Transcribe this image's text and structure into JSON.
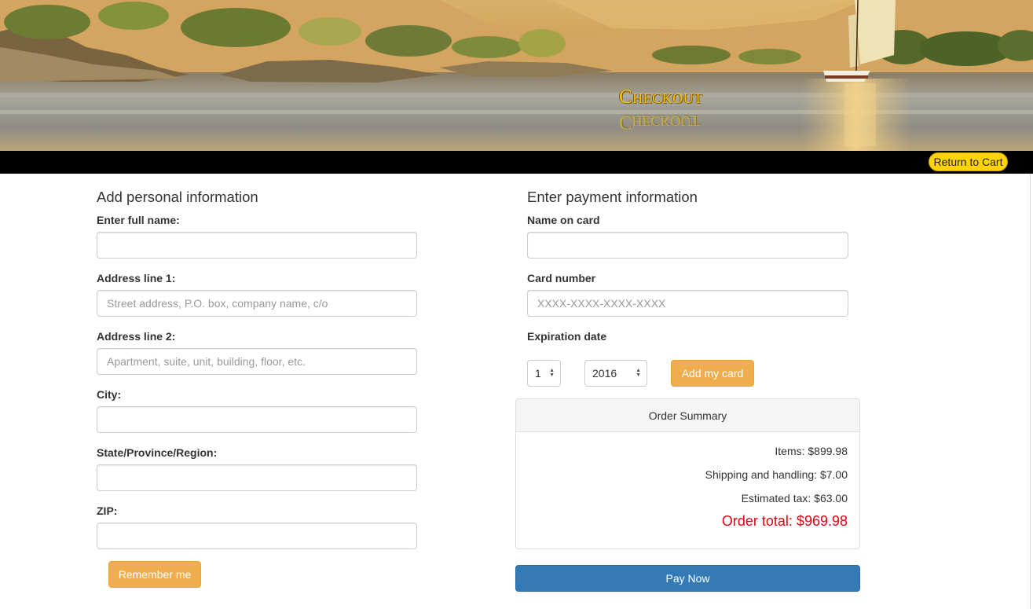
{
  "banner": {
    "title": "Checkout"
  },
  "topbar": {
    "return_label": "Return to Cart",
    "accent_color": "#ffd400"
  },
  "personal": {
    "heading": "Add personal information",
    "fields": [
      {
        "label": "Enter full name:",
        "value": "",
        "placeholder": ""
      },
      {
        "label": "Address line 1:",
        "value": "",
        "placeholder": "Street address, P.O. box, company name, c/o"
      },
      {
        "label": "Address line 2:",
        "value": "",
        "placeholder": "Apartment, suite, unit, building, floor, etc."
      },
      {
        "label": "City:",
        "value": "",
        "placeholder": ""
      },
      {
        "label": "State/Province/Region:",
        "value": "",
        "placeholder": ""
      },
      {
        "label": "ZIP:",
        "value": "",
        "placeholder": ""
      }
    ],
    "remember_label": "Remember me"
  },
  "payment": {
    "heading": "Enter payment information",
    "name_label": "Name on card",
    "name_value": "",
    "card_label": "Card number",
    "card_placeholder": "XXXX-XXXX-XXXX-XXXX",
    "exp_label": "Expiration date",
    "exp_month": "1",
    "exp_year": "2016",
    "add_card_label": "Add my card"
  },
  "summary": {
    "header": "Order Summary",
    "items": "Items: $899.98",
    "shipping": "Shipping and handling: $7.00",
    "tax": "Estimated tax: $63.00",
    "total": "Order total: $969.98",
    "total_color": "#e4000f"
  },
  "pay_now_label": "Pay Now",
  "colors": {
    "orange_button": "#f0ad4e",
    "blue_button": "#337ab7"
  }
}
